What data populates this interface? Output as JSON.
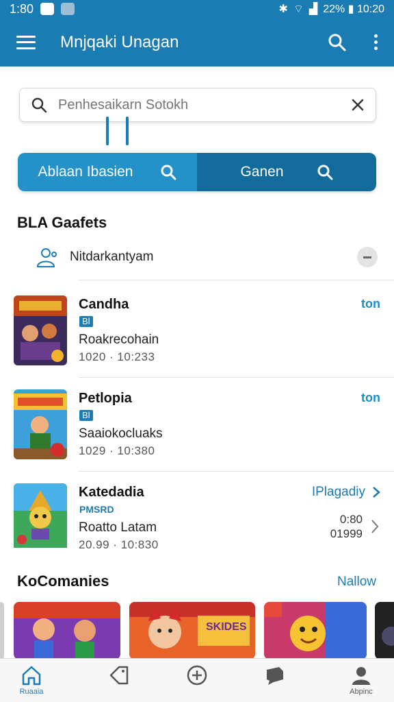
{
  "status_bar": {
    "time": "1:80",
    "right_text": "22% ▮ 10:20"
  },
  "app_bar": {
    "title": "Mnjqaki Unagan"
  },
  "search": {
    "placeholder": "Penhesaikarn Sotokh"
  },
  "segmented": {
    "left_label": "Ablaan Ibasien",
    "right_label": "Ganen"
  },
  "section1": {
    "title": "BLA Gaafets",
    "filter_label": "Nitdarkantyam"
  },
  "rows": [
    {
      "name": "Candha",
      "badge": "Bl",
      "subtitle": "Roakrecohain",
      "meta": "1020 · 10:233",
      "action": "ton"
    },
    {
      "name": "Petlopia",
      "badge": "Bl",
      "subtitle": "Saaiokocluaks",
      "meta": "1029 · 10:380",
      "action": "ton"
    },
    {
      "name": "Katedadia",
      "badge": "PMSRD",
      "subtitle": "Roatto Latam",
      "meta": "20.99 · 10:830",
      "action": "IPlagadiy",
      "nums": [
        "0:80",
        "01999"
      ]
    }
  ],
  "section2": {
    "title": "KoComanies",
    "link": "Nallow"
  },
  "cards": [
    {
      "caption": ""
    },
    {
      "caption": "SKIDES"
    },
    {
      "caption": ""
    },
    {
      "caption": ""
    }
  ],
  "bottom_nav": [
    {
      "label": "Ruaaia",
      "icon": "home-icon"
    },
    {
      "label": "",
      "icon": "tag-icon"
    },
    {
      "label": "",
      "icon": "plus-circle-icon"
    },
    {
      "label": "",
      "icon": "chat-icon"
    },
    {
      "label": "Abpinc",
      "icon": "profile-icon"
    }
  ],
  "colors": {
    "primary": "#1b7bb3",
    "primary_light": "#2591c9",
    "primary_dark": "#136b9c"
  }
}
